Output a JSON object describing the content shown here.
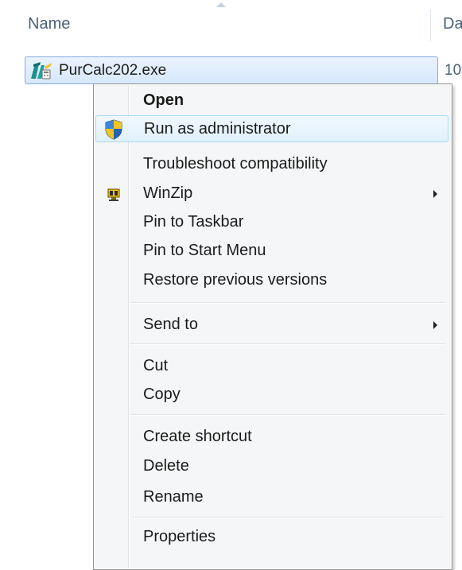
{
  "columns": {
    "name": "Name",
    "date": "Da"
  },
  "file": {
    "name": "PurCalc202.exe",
    "date_partial": "10",
    "icon": "purcalc-app-icon"
  },
  "context_menu": {
    "items": [
      {
        "label": "Open",
        "bold": true
      },
      {
        "label": "Run as administrator",
        "icon": "uac-shield-icon",
        "highlighted": true
      },
      {
        "label": "Troubleshoot compatibility"
      },
      {
        "label": "WinZip",
        "icon": "winzip-icon",
        "submenu": true
      },
      {
        "label": "Pin to Taskbar"
      },
      {
        "label": "Pin to Start Menu"
      },
      {
        "label": "Restore previous versions"
      },
      {
        "label": "Send to",
        "submenu": true
      },
      {
        "label": "Cut"
      },
      {
        "label": "Copy"
      },
      {
        "label": "Create shortcut"
      },
      {
        "label": "Delete"
      },
      {
        "label": "Rename"
      },
      {
        "label": "Properties"
      }
    ]
  },
  "colors": {
    "selection_border": "#84acdd",
    "hover_border": "#a8d8f5",
    "menu_background": "#f5f6f7",
    "header_text": "#4c607a"
  }
}
